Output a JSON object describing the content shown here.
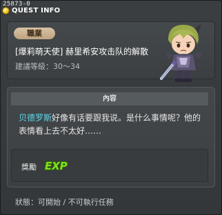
{
  "window": {
    "quest_id": "25873-0",
    "title": "QUEST INFO"
  },
  "header": {
    "job_badge": "職業",
    "quest_name": "[爆莉萌天使] 赫里希安攻击队的解散",
    "level_text": "建議等級：30～34"
  },
  "content": {
    "section_title": "內容",
    "npc_name": "贝德罗斯",
    "description": "好像有话要跟我说。是什么事情呢？他的表情看上去不太好……"
  },
  "reward": {
    "label": "獎勵",
    "exp_text": "EXP"
  },
  "status": {
    "text": "狀態：可開始 / 不可執行任務"
  },
  "icons": {
    "title_icon": "gold-coin-icon",
    "npc_portrait": "npc-character-portrait",
    "reward_icon": "exp-icon"
  },
  "colors": {
    "npc_link": "#5fd9ec",
    "badge": "#d9c3a3",
    "exp_green": "#7fe21a"
  }
}
